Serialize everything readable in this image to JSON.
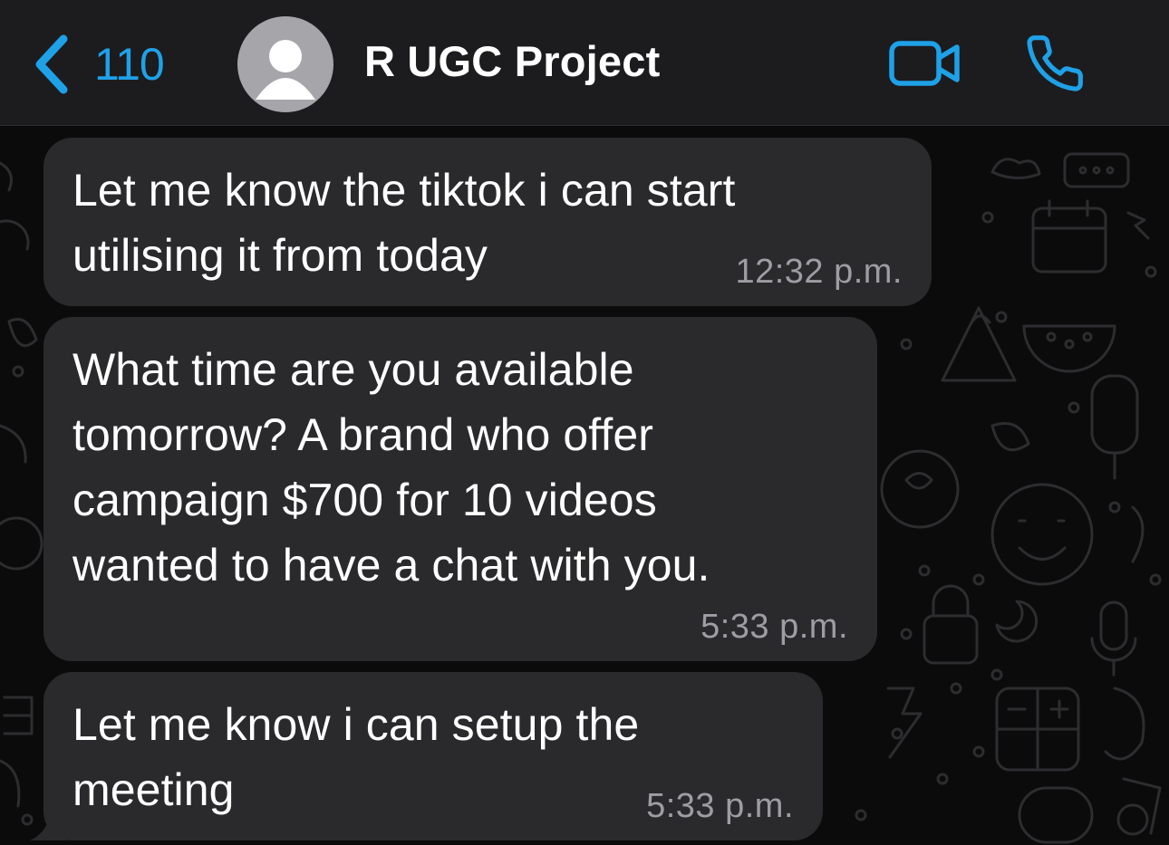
{
  "header": {
    "back_count": "110",
    "title": "R UGC Project",
    "back_icon": "chevron-left-icon",
    "video_icon": "video-camera-icon",
    "call_icon": "phone-icon",
    "avatar_icon": "person-silhouette-icon"
  },
  "messages": [
    {
      "text": "Let me know the tiktok i can start\nutilising it from today",
      "time": "12:32 p.m."
    },
    {
      "text": "What time are you available\ntomorrow? A brand who offer\ncampaign $700 for 10 videos\nwanted to have a chat with you.",
      "time": "5:33 p.m."
    },
    {
      "text": "Let me know i can setup the\nmeeting",
      "time": "5:33 p.m."
    }
  ],
  "colors": {
    "accent": "#1fa1e8",
    "header_bg": "#1c1c1e",
    "chat_bg": "#0b0b0c",
    "bubble_bg": "#2a2a2c",
    "timestamp": "#9d9da3",
    "avatar_bg": "#a5a5aa"
  }
}
